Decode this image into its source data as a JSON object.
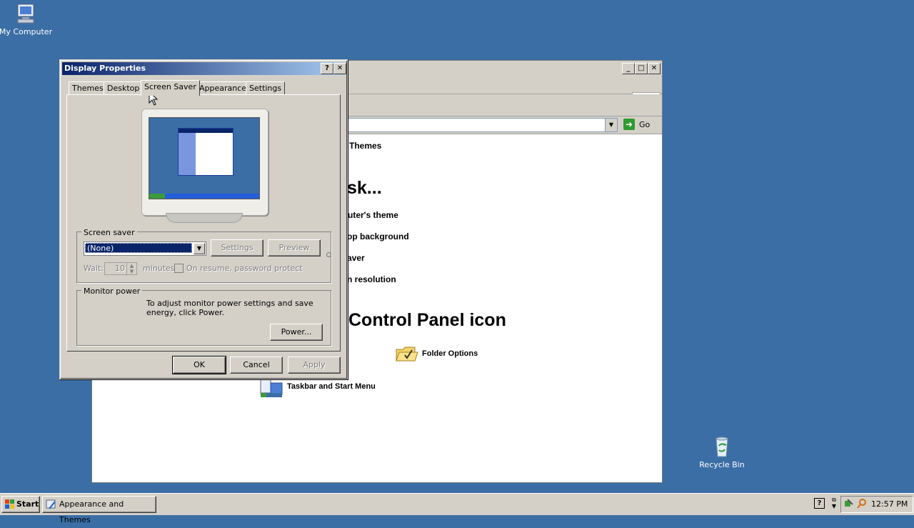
{
  "desktop": {
    "icons": [
      {
        "label": "My Computer"
      },
      {
        "label": "Recycle Bin"
      }
    ]
  },
  "control_panel": {
    "go_label": "Go",
    "links": [
      "Themes",
      "uter's theme",
      "op background",
      "aver",
      "n resolution"
    ],
    "heading_task": "sk...",
    "heading_icon": "Control Panel icon",
    "icons": [
      {
        "label": "Folder Options",
        "icon": "folder-options-icon"
      },
      {
        "label": "Taskbar and Start Menu",
        "icon": "taskbar-start-menu-icon"
      }
    ]
  },
  "dialog": {
    "title": "Display Properties",
    "help_label": "?",
    "close_label": "✕",
    "tabs": [
      "Themes",
      "Desktop",
      "Screen Saver",
      "Appearance",
      "Settings"
    ],
    "active_tab": "Screen Saver",
    "screen_saver": {
      "group_label": "Screen saver",
      "selected": "(None)",
      "settings_label": "Settings",
      "preview_label": "Preview",
      "wait_label": "Wait:",
      "wait_value": "10",
      "minutes_label": "minutes",
      "password_label": "On resume, password protect"
    },
    "monitor_power": {
      "group_label": "Monitor power",
      "description": "To adjust monitor power settings and save energy, click Power.",
      "power_label": "Power..."
    },
    "ok_label": "OK",
    "cancel_label": "Cancel",
    "apply_label": "Apply"
  },
  "taskbar": {
    "start_label": "Start",
    "items": [
      "Appearance and Themes"
    ],
    "clock": "12:57 PM",
    "help_label": "?"
  },
  "colors": {
    "desktop": "#3a6ea5",
    "title_active": "#0a246a",
    "face": "#d4d0c8"
  }
}
